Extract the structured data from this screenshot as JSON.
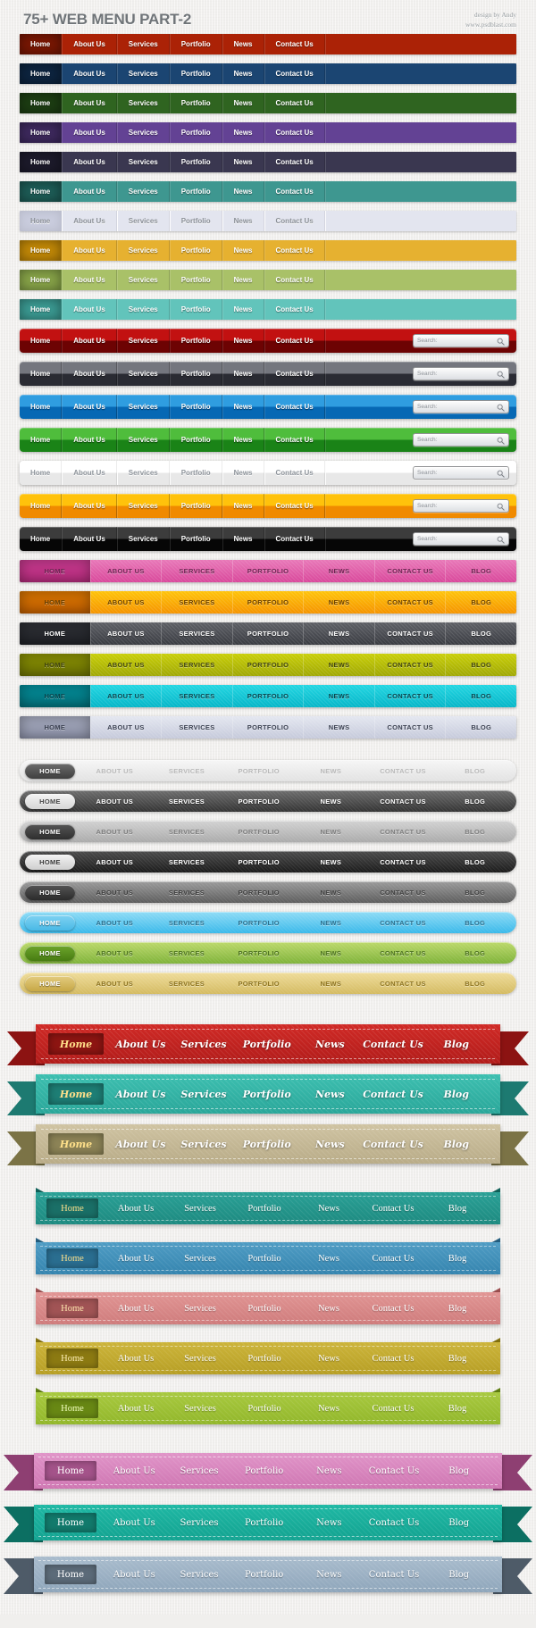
{
  "header": {
    "title": "75+ WEB MENU PART-2",
    "credit_line1": "design by Andy",
    "credit_line2": "www.psdblast.com"
  },
  "labels": {
    "home": "Home",
    "about": "About Us",
    "services": "Services",
    "portfolio": "Portfolio",
    "news": "News",
    "contact": "Contact Us",
    "blog": "Blog",
    "home_caps": "HOME",
    "about_caps": "ABOUT US",
    "services_caps": "SERVICES",
    "portfolio_caps": "PORTFOLIO",
    "news_caps": "NEWS",
    "contact_caps": "CONTACT US",
    "blog_caps": "BLOG"
  },
  "search": {
    "placeholder": "Search:",
    "icon": "search-icon"
  },
  "group_a": {
    "name": "flat-solid-menu-bars",
    "rows": [
      {
        "id": "red",
        "bg": "#ab2206",
        "active": "#7c1703",
        "light": false
      },
      {
        "id": "navy",
        "bg": "#1b4572",
        "active": "#0d2541",
        "light": false
      },
      {
        "id": "green",
        "bg": "#2f6420",
        "active": "#1d3f13",
        "light": false
      },
      {
        "id": "purple",
        "bg": "#634294",
        "active": "#3f2a60",
        "light": false
      },
      {
        "id": "charcoal",
        "bg": "#3a3750",
        "active": "#1d1b2c",
        "light": false
      },
      {
        "id": "teal",
        "bg": "#3e9790",
        "active": "#1e5f59",
        "light": false
      },
      {
        "id": "white",
        "bg": "#e3e5ef",
        "active": "#c9ccdd",
        "light": true
      },
      {
        "id": "gold",
        "bg": "#e6b130",
        "active": "#c78c07",
        "light": false
      },
      {
        "id": "olive",
        "bg": "#a9c168",
        "active": "#8ba84a",
        "light": false
      },
      {
        "id": "mint",
        "bg": "#62c4bb",
        "active": "#3c9e96",
        "light": false
      }
    ]
  },
  "group_b": {
    "name": "glossy-menu-bars-with-search",
    "rows": [
      {
        "id": "crimson",
        "top": "#c21111",
        "bottom": "#6d0303",
        "light": false
      },
      {
        "id": "slate",
        "top": "#74767e",
        "bottom": "#2a2b33",
        "light": false
      },
      {
        "id": "blue",
        "top": "#2f9de0",
        "bottom": "#0668b4",
        "light": false
      },
      {
        "id": "green",
        "top": "#4fbd3c",
        "bottom": "#1a8317",
        "light": false
      },
      {
        "id": "white",
        "top": "#ffffff",
        "bottom": "#e8e8e8",
        "light": true
      },
      {
        "id": "orange",
        "top": "#ffc20b",
        "bottom": "#f08a00",
        "light": false
      },
      {
        "id": "black",
        "top": "#3c3c3c",
        "bottom": "#060606",
        "light": false
      }
    ]
  },
  "group_c": {
    "name": "uppercase-textured-bars",
    "rows": [
      {
        "id": "pink",
        "top": "#e878b8",
        "bottom": "#d9489b",
        "active_top": "#cf3d95",
        "active_bottom": "#b52b7c",
        "text": "#6b2450",
        "dark": false
      },
      {
        "id": "orange",
        "top": "#ffc40a",
        "bottom": "#f59400",
        "active_top": "#e07a00",
        "active_bottom": "#c25f00",
        "text": "#6b4100",
        "dark": false
      },
      {
        "id": "gray",
        "top": "#5e6066",
        "bottom": "#3a3c42",
        "active_top": "#303238",
        "active_bottom": "#202227",
        "text": "#ffffff",
        "dark": true
      },
      {
        "id": "olive",
        "top": "#c9cf08",
        "bottom": "#a0a805",
        "active_top": "#8d9404",
        "active_bottom": "#6e7403",
        "text": "#40440c",
        "dark": false
      },
      {
        "id": "cyan",
        "top": "#23d6e2",
        "bottom": "#06b6c8",
        "active_top": "#04929f",
        "active_bottom": "#02727c",
        "text": "#06444c",
        "dark": false
      },
      {
        "id": "silver",
        "top": "#e4e7f0",
        "bottom": "#c6cadb",
        "active_top": "#a9aec2",
        "active_bottom": "#8f94ab",
        "text": "#3c4252",
        "dark": false
      }
    ]
  },
  "group_d": {
    "name": "rounded-pill-menu-bars",
    "rows": [
      {
        "id": "white",
        "top": "#f6f6f6",
        "bottom": "#e2e2e2",
        "text": "#b9b9b9",
        "pill_top": "#6b6b6b",
        "pill_bottom": "#3f3f3f",
        "pill_text": "#ffffff"
      },
      {
        "id": "darkgray",
        "top": "#6e6e6e",
        "bottom": "#343434",
        "text": "#ffffff",
        "pill_top": "#f4f4f4",
        "pill_bottom": "#d6d6d6",
        "pill_text": "#4a4a4a"
      },
      {
        "id": "midgray",
        "top": "#d2d2d2",
        "bottom": "#ababab",
        "text": "#7c7c7c",
        "pill_top": "#555555",
        "pill_bottom": "#2f2f2f",
        "pill_text": "#ffffff"
      },
      {
        "id": "black",
        "top": "#4c4c4c",
        "bottom": "#1c1c1c",
        "text": "#ffffff",
        "pill_top": "#f2f2f2",
        "pill_bottom": "#cfcfcf",
        "pill_text": "#3b3b3b"
      },
      {
        "id": "gunmetal",
        "top": "#9b9b9b",
        "bottom": "#5d5d5d",
        "text": "#3f3f3f",
        "pill_top": "#555555",
        "pill_bottom": "#2b2b2b",
        "pill_text": "#ffffff"
      },
      {
        "id": "skyblue",
        "top": "#8fdcf6",
        "bottom": "#3ab9ea",
        "text": "#2a6e8c",
        "pill_top": "#7fd2f2",
        "pill_bottom": "#49b9e6",
        "pill_text": "#ffffff"
      },
      {
        "id": "applegreen",
        "top": "#bcd96b",
        "bottom": "#7fb33a",
        "text": "#4d7320",
        "pill_top": "#6da52c",
        "pill_bottom": "#477c12",
        "pill_text": "#ffffff"
      },
      {
        "id": "sand",
        "top": "#efdc9a",
        "bottom": "#d4bb62",
        "text": "#8d7420",
        "pill_top": "#e3cb7f",
        "pill_bottom": "#c7a846",
        "pill_text": "#ffffff"
      }
    ]
  },
  "group_e": {
    "name": "script-ribbon-banners",
    "rows": [
      {
        "id": "red",
        "band_top": "#d02a26",
        "band_bottom": "#b21c1a",
        "tail": "#8c1312",
        "home_bg": "#8e1512",
        "home_text": "#ffe08a"
      },
      {
        "id": "teal",
        "band_top": "#3dbfb0",
        "band_bottom": "#2aa79a",
        "tail": "#1d7a71",
        "home_bg": "#1e7f76",
        "home_text": "#ffe08a"
      },
      {
        "id": "khaki",
        "band_top": "#cfc3a2",
        "band_bottom": "#b9ac88",
        "tail": "#7b7346",
        "home_bg": "#8d8457",
        "home_text": "#ffe08a"
      }
    ]
  },
  "group_f": {
    "name": "fold-tab-ribbons",
    "rows": [
      {
        "id": "teal",
        "band_top": "#2aa096",
        "band_bottom": "#1d8a80",
        "fold": "#11615a",
        "home_bg": "#1a6f67",
        "home_text": "#ffe08a"
      },
      {
        "id": "blue",
        "band_top": "#4f9cc4",
        "band_bottom": "#3585af",
        "fold": "#255f80",
        "home_bg": "#2a6e90",
        "home_text": "#ffe08a"
      },
      {
        "id": "rose",
        "band_top": "#e19594",
        "band_bottom": "#cf7c7c",
        "fold": "#9c4f50",
        "home_bg": "#a15455",
        "home_text": "#ffe8b0"
      },
      {
        "id": "mustard",
        "band_top": "#ccb43a",
        "band_bottom": "#b79f25",
        "fold": "#84720f",
        "home_bg": "#8c7a12",
        "home_text": "#fff0b8"
      },
      {
        "id": "green",
        "band_top": "#a8c93f",
        "band_bottom": "#92b72b",
        "fold": "#5f7e12",
        "home_bg": "#688814",
        "home_text": "#f2ffc0"
      }
    ]
  },
  "group_g": {
    "name": "wide-tail-ribbons",
    "rows": [
      {
        "id": "orchid",
        "band_top": "#e094c8",
        "band_bottom": "#cf76b2",
        "tail": "#8e3f72",
        "home_bg": "#a4538a",
        "home_text": "#ffffff"
      },
      {
        "id": "teal",
        "band_top": "#1fb8a4",
        "band_bottom": "#13a391",
        "tail": "#0c6f62",
        "home_bg": "#127a6c",
        "home_text": "#ffffff"
      },
      {
        "id": "steel",
        "band_top": "#a9bccd",
        "band_bottom": "#8fa6bb",
        "tail": "#4e5b68",
        "home_bg": "#5c6b79",
        "home_text": "#ffffff"
      }
    ]
  }
}
